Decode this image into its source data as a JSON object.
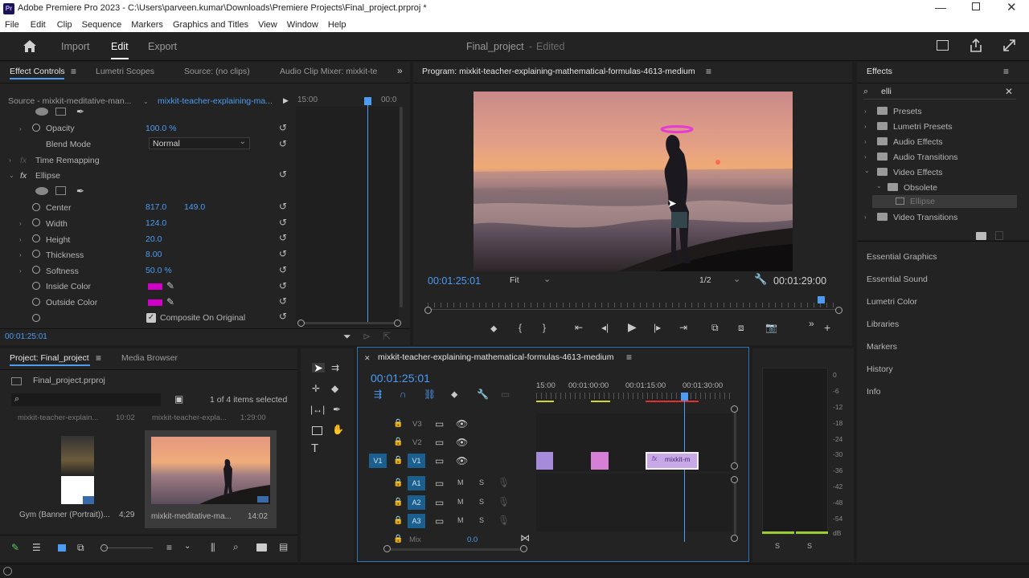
{
  "window": {
    "title": "Adobe Premiere Pro 2023 - C:\\Users\\parveen.kumar\\Downloads\\Premiere Projects\\Final_project.prproj *",
    "app_badge": "Pr"
  },
  "menu": [
    "File",
    "Edit",
    "Clip",
    "Sequence",
    "Markers",
    "Graphics and Titles",
    "View",
    "Window",
    "Help"
  ],
  "header": {
    "import": "Import",
    "edit": "Edit",
    "export": "Export",
    "project_name": "Final_project",
    "status": "Edited"
  },
  "effect_controls": {
    "tabs": [
      "Effect Controls",
      "Lumetri Scopes",
      "Source: (no clips)",
      "Audio Clip Mixer: mixkit-te"
    ],
    "source": "Source - mixkit-meditative-man...",
    "clip": "mixkit-teacher-explaining-ma...",
    "timecode_start": "15:00",
    "timecode_end": "00:0",
    "opacity": {
      "label": "Opacity",
      "value": "100.0 %"
    },
    "blend": {
      "label": "Blend Mode",
      "value": "Normal"
    },
    "time_remap": "Time Remapping",
    "ellipse": "Ellipse",
    "center": {
      "label": "Center",
      "x": "817.0",
      "y": "149.0"
    },
    "width": {
      "label": "Width",
      "value": "124.0"
    },
    "height": {
      "label": "Height",
      "value": "20.0"
    },
    "thickness": {
      "label": "Thickness",
      "value": "8.00"
    },
    "softness": {
      "label": "Softness",
      "value": "50.0 %"
    },
    "inside_color": "Inside Color",
    "outside_color": "Outside Color",
    "composite": "Composite On Original",
    "footer_time": "00:01:25:01",
    "fx": "fx"
  },
  "program": {
    "title": "Program: mixkit-teacher-explaining-mathematical-formulas-4613-medium",
    "current_time": "00:01:25:01",
    "fit": "Fit",
    "resolution": "1/2",
    "duration": "00:01:29:00"
  },
  "effects": {
    "title": "Effects",
    "search": "elli",
    "tree": [
      "Presets",
      "Lumetri Presets",
      "Audio Effects",
      "Audio Transitions",
      "Video Effects",
      "Obsolete",
      "Ellipse",
      "Video Transitions"
    ],
    "links": [
      "Essential Graphics",
      "Essential Sound",
      "Lumetri Color",
      "Libraries",
      "Markers",
      "History",
      "Info"
    ]
  },
  "project": {
    "tabs": [
      "Project: Final_project",
      "Media Browser"
    ],
    "file": "Final_project.prproj",
    "selection": "1 of 4 items selected",
    "top_labels": [
      "mixkit-teacher-explain...",
      "10:02",
      "mixkit-teacher-expla...",
      "1:29:00"
    ],
    "items": [
      {
        "name": "Gym (Banner (Portrait))...",
        "duration": "4;29"
      },
      {
        "name": "mixkit-meditative-ma...",
        "duration": "14:02"
      }
    ]
  },
  "timeline": {
    "title": "mixkit-teacher-explaining-mathematical-formulas-4613-medium",
    "time": "00:01:25:01",
    "ruler": [
      "15:00",
      "00:01:00:00",
      "00:01:15:00",
      "00:01:30:00"
    ],
    "video_tracks": [
      "V3",
      "V2",
      "V1"
    ],
    "source_patch": "V1",
    "audio_tracks": [
      "A1",
      "A2",
      "A3"
    ],
    "mix": "Mix",
    "mix_value": "0.0",
    "m": "M",
    "s": "S",
    "clip_label": "mixkit-m",
    "fx": "fx"
  },
  "meter": {
    "scale": [
      "0",
      "-6",
      "-12",
      "-18",
      "-24",
      "-30",
      "-36",
      "-42",
      "-48",
      "-54",
      "dB"
    ],
    "s": "S"
  },
  "colors": {
    "accent": "#4b9cf2",
    "ellipse": "#d100c8",
    "clip_purple": "#a58bd9",
    "clip_pink": "#d57fd6"
  }
}
